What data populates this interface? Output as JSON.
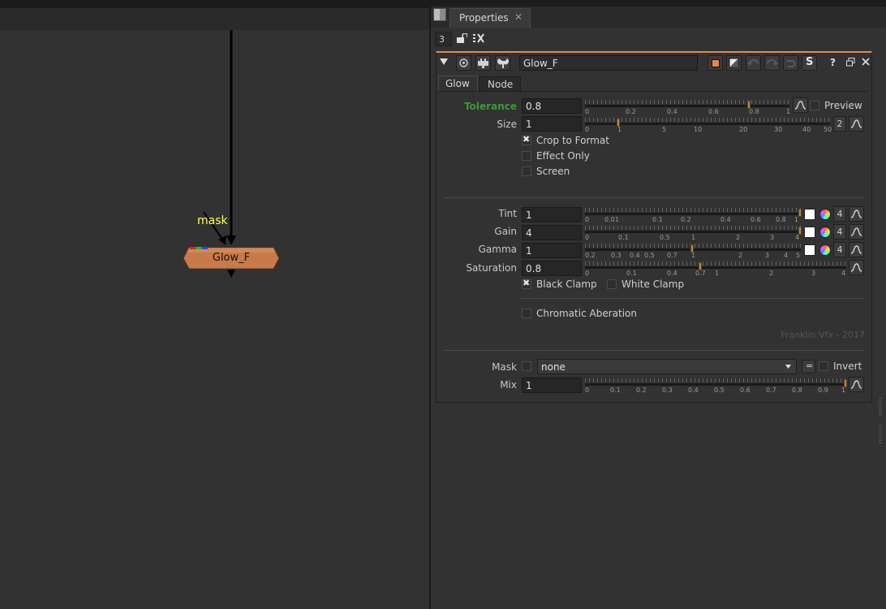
{
  "nodegraph": {
    "node_label": "Glow_F",
    "mask_input_label": "mask"
  },
  "properties": {
    "tab_label": "Properties",
    "tab_close": "✕",
    "max_panels": "3",
    "node_name": "Glow_F",
    "help_label": "?",
    "s_label": "S",
    "subtabs": [
      "Glow",
      "Node"
    ],
    "tolerance": {
      "label": "Tolerance",
      "value": "0.8",
      "ticks": [
        "0",
        "0.2",
        "0.4",
        "0.6",
        "0.8",
        "1"
      ],
      "slider_fraction": 0.8,
      "preview_label": "Preview"
    },
    "size": {
      "label": "Size",
      "value": "1",
      "ticks": [
        "0",
        "1",
        "5",
        "10",
        "20",
        "30",
        "40",
        "50"
      ],
      "channel_count": "2"
    },
    "crop_to_format": {
      "label": "Crop to Format",
      "checked": true
    },
    "effect_only": {
      "label": "Effect Only",
      "checked": false
    },
    "screen": {
      "label": "Screen",
      "checked": false
    },
    "tint": {
      "label": "Tint",
      "value": "1",
      "ticks": [
        "0",
        "0.01",
        "0.1",
        "0.2",
        "0.4",
        "0.6",
        "0.8",
        "1"
      ],
      "channel_count": "4"
    },
    "gain": {
      "label": "Gain",
      "value": "4",
      "ticks": [
        "0",
        "0.1",
        "0.5",
        "1",
        "2",
        "3",
        "4"
      ],
      "channel_count": "4"
    },
    "gamma": {
      "label": "Gamma",
      "value": "1",
      "ticks": [
        "0.2",
        "0.3",
        "0.4",
        "0.5",
        "0.7",
        "1",
        "2",
        "3",
        "4",
        "5"
      ],
      "channel_count": "4"
    },
    "saturation": {
      "label": "Saturation",
      "value": "0.8",
      "ticks": [
        "0",
        "0.1",
        "0.4",
        "0.7",
        "1",
        "2",
        "3",
        "4"
      ]
    },
    "black_clamp": {
      "label": "Black Clamp",
      "checked": true
    },
    "white_clamp": {
      "label": "White Clamp",
      "checked": false
    },
    "chromatic_aberation": {
      "label": "Chromatic Aberation",
      "checked": false
    },
    "credit": "Franklin Vfx - 2017",
    "mask": {
      "label": "Mask",
      "value": "none",
      "equals_label": "=",
      "invert_label": "Invert"
    },
    "mix": {
      "label": "Mix",
      "value": "1",
      "ticks": [
        "0",
        "0.1",
        "0.2",
        "0.3",
        "0.4",
        "0.5",
        "0.6",
        "0.7",
        "0.8",
        "0.9",
        "1"
      ]
    }
  },
  "colors": {
    "node_fill": "#c97a4a",
    "tolerance_label": "#3a9a3a",
    "mask_text": "#ffff55",
    "accent_orange": "#e08a50"
  }
}
